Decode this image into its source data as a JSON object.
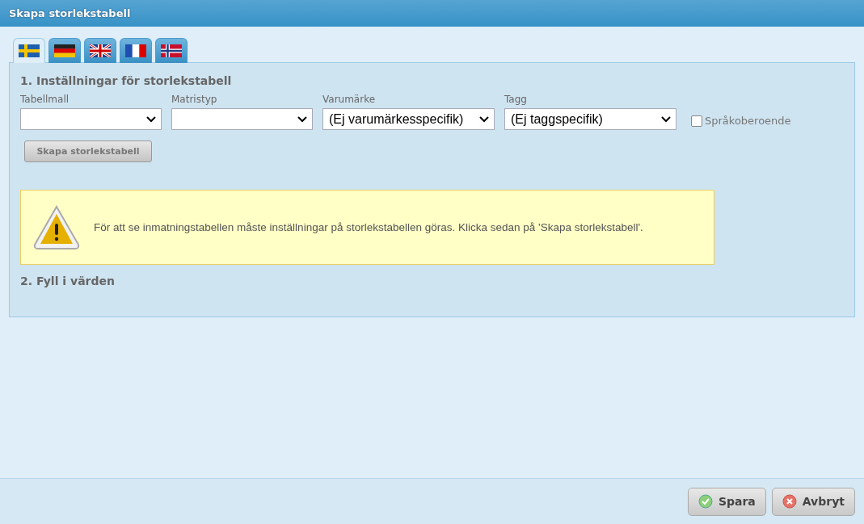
{
  "window": {
    "title": "Skapa storlekstabell"
  },
  "tabs": [
    {
      "kind": "se",
      "selected": true
    },
    {
      "kind": "de",
      "selected": false
    },
    {
      "kind": "gb",
      "selected": false
    },
    {
      "kind": "fr",
      "selected": false
    },
    {
      "kind": "no",
      "selected": false
    }
  ],
  "section_1": {
    "heading": "1. Inställningar för storlekstabell",
    "fields": [
      {
        "label": "Tabellmall"
      },
      {
        "label": "Matristyp"
      },
      {
        "label": "Varumärke",
        "value": "(Ej varumärkesspecifik)"
      },
      {
        "label": "Tagg",
        "value": "(Ej taggspecifik)"
      }
    ],
    "checkbox": {
      "label": "Språkoberoende",
      "checked": false
    },
    "create_button": "Skapa storlekstabell",
    "warning": "För att se inmatningstabellen måste inställningar på storlekstabellen göras. Klicka sedan på 'Skapa storlekstabell'."
  },
  "section_2": {
    "heading": "2. Fyll i värden"
  },
  "buttons": [
    {
      "kind": "save",
      "label": "Spara"
    },
    {
      "kind": "cancel",
      "label": "Avbryt"
    }
  ]
}
